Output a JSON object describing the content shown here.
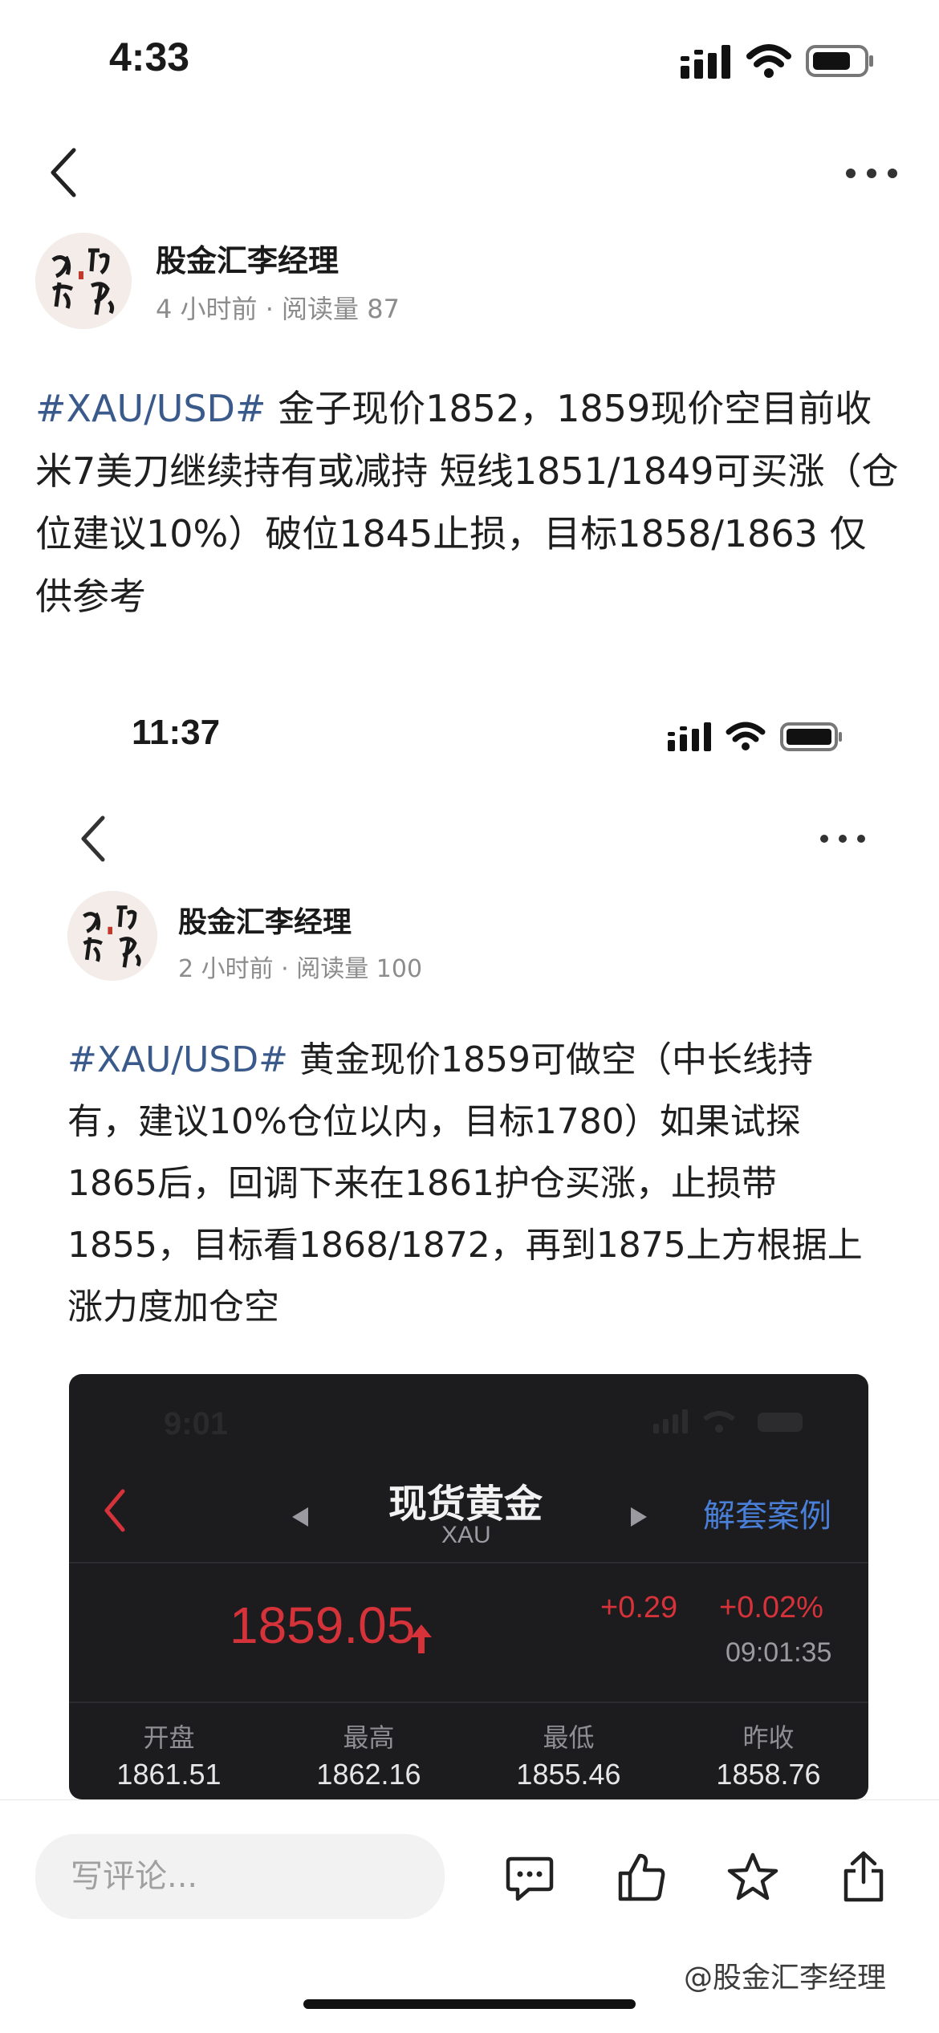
{
  "status_bar": {
    "time": "4:33"
  },
  "nav": {
    "back": "back",
    "more": "more"
  },
  "post1": {
    "author": "股金汇李经理",
    "meta": "4 小时前 · 阅读量 87",
    "hashtag": "#XAU/USD#",
    "body": " 金子现价1852，1859现价空目前收米7美刀继续持有或减持 短线1851/1849可买涨（仓位建议10%）破位1845止损，目标1858/1863 仅供参考"
  },
  "embedded": {
    "status_time": "11:37",
    "author": "股金汇李经理",
    "meta": "2 小时前 · 阅读量 100",
    "hashtag": "#XAU/USD#",
    "body": " 黄金现价1859可做空（中长线持有，建议10%仓位以内，目标1780）如果试探1865后，回调下来在1861护仓买涨，止损带1855，目标看1868/1872，再到1875上方根据上涨力度加仓空"
  },
  "quote_card": {
    "status_time": "9:01",
    "title": "现货黄金",
    "subtitle": "XAU",
    "right_link": "解套案例",
    "price": "1859.05",
    "change": "+0.29",
    "change_pct": "+0.02%",
    "timestamp": "09:01:35",
    "stats": [
      {
        "label": "开盘",
        "value": "1861.51"
      },
      {
        "label": "最高",
        "value": "1862.16"
      },
      {
        "label": "最低",
        "value": "1855.46"
      },
      {
        "label": "昨收",
        "value": "1858.76"
      }
    ],
    "colors": {
      "up": "#d6323a",
      "accent": "#4a7fd8"
    }
  },
  "bottom_bar": {
    "comment_placeholder": "写评论...",
    "actions": [
      "comment-icon",
      "like-icon",
      "favorite-icon",
      "share-icon"
    ]
  },
  "watermark": "@股金汇李经理"
}
